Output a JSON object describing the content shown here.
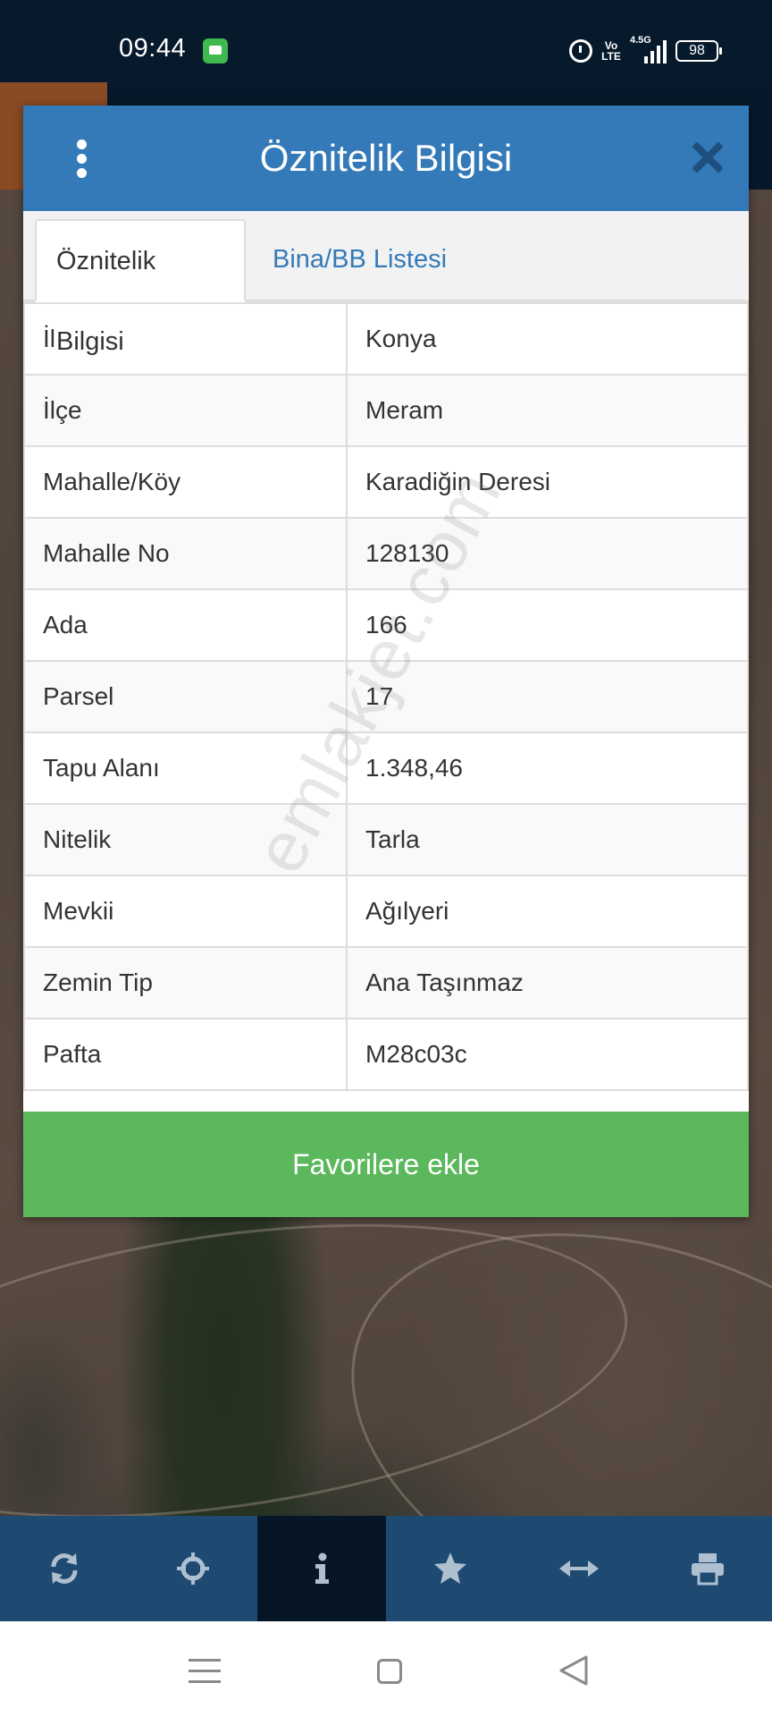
{
  "status_bar": {
    "time": "09:44",
    "network": "4.5G",
    "volte": "Vo LTE",
    "battery": "98"
  },
  "dialog": {
    "title": "Öznitelik Bilgisi",
    "tabs": [
      {
        "label": "Öznitelik Bilgisi",
        "active": true
      },
      {
        "label": "Bina/BB Listesi",
        "active": false
      }
    ],
    "rows": [
      {
        "key": "İl",
        "value": "Konya"
      },
      {
        "key": "İlçe",
        "value": "Meram"
      },
      {
        "key": "Mahalle/Köy",
        "value": "Karadiğin Deresi"
      },
      {
        "key": "Mahalle No",
        "value": "128130"
      },
      {
        "key": "Ada",
        "value": "166"
      },
      {
        "key": "Parsel",
        "value": "17"
      },
      {
        "key": "Tapu Alanı",
        "value": "1.348,46"
      },
      {
        "key": "Nitelik",
        "value": "Tarla"
      },
      {
        "key": "Mevkii",
        "value": "Ağılyeri"
      },
      {
        "key": "Zemin Tip",
        "value": "Ana Taşınmaz"
      },
      {
        "key": "Pafta",
        "value": "M28c03c"
      }
    ],
    "favorite_button": "Favorilere ekle",
    "watermark": "emlakjet.com"
  },
  "toolbar": {
    "items": [
      {
        "icon": "refresh-icon"
      },
      {
        "icon": "locate-icon"
      },
      {
        "icon": "info-icon",
        "active": true
      },
      {
        "icon": "star-icon"
      },
      {
        "icon": "measure-icon"
      },
      {
        "icon": "print-icon"
      }
    ]
  },
  "colors": {
    "header": "#347ab8",
    "favorite_button": "#5cb85c",
    "toolbar": "#1e4a72",
    "toolbar_active": "#061626",
    "status_bar": "#061a2c"
  }
}
